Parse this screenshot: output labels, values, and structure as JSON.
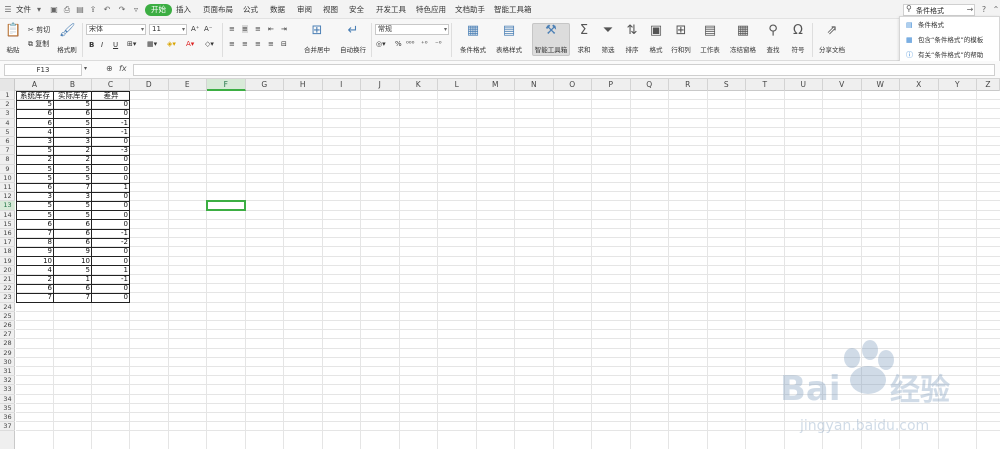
{
  "menubar": {
    "file_label": "文件",
    "tabs": [
      "开始",
      "插入",
      "页面布局",
      "公式",
      "数据",
      "审阅",
      "视图",
      "安全",
      "开发工具",
      "特色应用",
      "文档助手",
      "智能工具箱"
    ],
    "search_value": "条件格式"
  },
  "search_dropdown": {
    "items": [
      "条件格式",
      "包含“条件格式”的模板",
      "有关“条件格式”的帮助"
    ]
  },
  "ribbon": {
    "paste": "粘贴",
    "cut": "剪切",
    "copy": "复制",
    "format_painter": "格式刷",
    "font_name": "宋体",
    "font_size": "11",
    "merge_center": "合并居中",
    "wrap_text": "自动换行",
    "number_format": "常规",
    "conditional_format": "条件格式",
    "table_style": "表格样式",
    "smart_toolbox": "智能工具箱",
    "sum": "求和",
    "filter": "筛选",
    "sort": "排序",
    "format": "格式",
    "row_col": "行和列",
    "worksheet": "工作表",
    "freeze": "冻结窗格",
    "find": "查找",
    "symbol": "符号",
    "share": "分享文档"
  },
  "formula_bar": {
    "name_box": "F13",
    "fx": "fx"
  },
  "sheet": {
    "columns": [
      "A",
      "B",
      "C",
      "D",
      "E",
      "F",
      "G",
      "H",
      "I",
      "J",
      "K",
      "L",
      "M",
      "N",
      "O",
      "P",
      "Q",
      "R",
      "S",
      "T",
      "U",
      "V",
      "W",
      "X",
      "Y",
      "Z"
    ],
    "active_column": "F",
    "active_row": 13,
    "row_count": 37,
    "headers": [
      "系统库存",
      "实际库存",
      "差异"
    ],
    "rows": [
      [
        "5",
        "5",
        "0"
      ],
      [
        "6",
        "6",
        "0"
      ],
      [
        "6",
        "5",
        "-1"
      ],
      [
        "4",
        "3",
        "-1"
      ],
      [
        "3",
        "3",
        "0"
      ],
      [
        "5",
        "2",
        "-3"
      ],
      [
        "2",
        "2",
        "0"
      ],
      [
        "5",
        "5",
        "0"
      ],
      [
        "5",
        "5",
        "0"
      ],
      [
        "6",
        "7",
        "1"
      ],
      [
        "3",
        "3",
        "0"
      ],
      [
        "5",
        "5",
        "0"
      ],
      [
        "5",
        "5",
        "0"
      ],
      [
        "6",
        "6",
        "0"
      ],
      [
        "7",
        "6",
        "-1"
      ],
      [
        "8",
        "6",
        "-2"
      ],
      [
        "9",
        "9",
        "0"
      ],
      [
        "10",
        "10",
        "0"
      ],
      [
        "4",
        "5",
        "1"
      ],
      [
        "2",
        "1",
        "-1"
      ],
      [
        "6",
        "6",
        "0"
      ],
      [
        "7",
        "7",
        "0"
      ]
    ]
  },
  "watermark": {
    "brand": "Bai",
    "brand2": "经验",
    "url": "jingyan.baidu.com"
  },
  "colors": {
    "accent": "#3cae43",
    "grid": "#e5e5e5"
  }
}
